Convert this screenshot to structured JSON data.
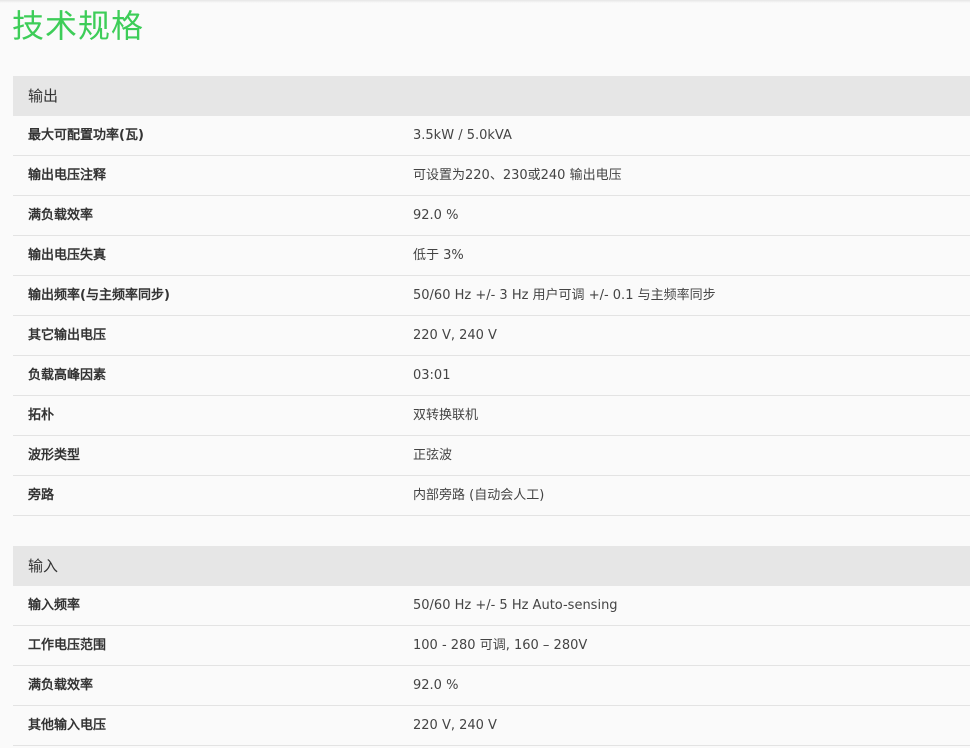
{
  "page": {
    "title": "技术规格"
  },
  "colors": {
    "title": "#3dcd58",
    "section_header_bg": "#e6e6e6",
    "page_bg": "#fafafa",
    "divider": "#e3e3e3"
  },
  "sections": [
    {
      "title": "输出",
      "rows": [
        {
          "label": "最大可配置功率(瓦)",
          "value": "3.5kW / 5.0kVA"
        },
        {
          "label": "输出电压注释",
          "value": "可设置为220、230或240 输出电压"
        },
        {
          "label": "满负载效率",
          "value": "92.0 %"
        },
        {
          "label": "输出电压失真",
          "value": "低于 3%"
        },
        {
          "label": "输出频率(与主频率同步)",
          "value": "50/60 Hz +/- 3 Hz 用户可调 +/- 0.1 与主频率同步"
        },
        {
          "label": "其它输出电压",
          "value": "220 V, 240 V"
        },
        {
          "label": "负载高峰因素",
          "value": "03:01"
        },
        {
          "label": "拓朴",
          "value": "双转换联机"
        },
        {
          "label": "波形类型",
          "value": "正弦波"
        },
        {
          "label": "旁路",
          "value": "内部旁路 (自动会人工)"
        }
      ]
    },
    {
      "title": "输入",
      "rows": [
        {
          "label": "输入频率",
          "value": "50/60 Hz +/- 5 Hz Auto-sensing"
        },
        {
          "label": "工作电压范围",
          "value": "100 - 280 可调, 160 – 280V"
        },
        {
          "label": "满负载效率",
          "value": "92.0 %"
        },
        {
          "label": "其他输入电压",
          "value": "220 V, 240 V"
        }
      ]
    }
  ]
}
